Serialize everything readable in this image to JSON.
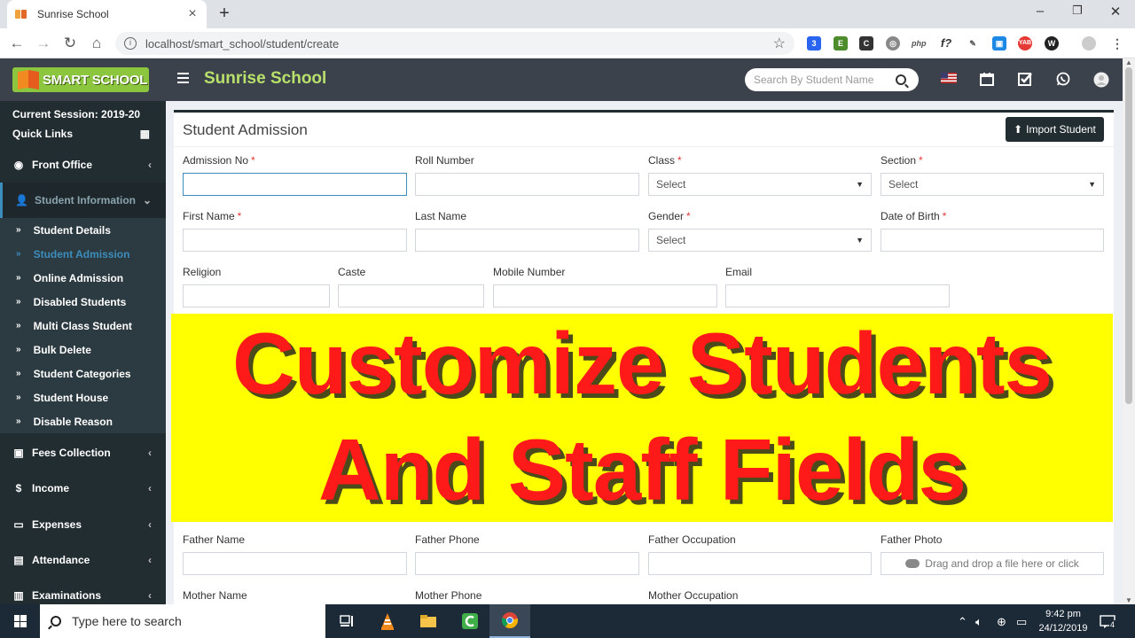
{
  "browser": {
    "tab_title": "Sunrise School",
    "tab_close": "×",
    "new_tab": "+",
    "url": "localhost/smart_school/student/create",
    "win_min": "–",
    "win_max": "❐",
    "win_close": "✕"
  },
  "header": {
    "logo_text": "SMART SCHOOL",
    "school_name": "Sunrise School",
    "search_placeholder": "Search By Student Name"
  },
  "sidebar": {
    "session": "Current Session: 2019-20",
    "quick_links": "Quick Links",
    "menus": [
      {
        "label": "Front Office",
        "icon": "desk-icon"
      },
      {
        "label": "Student Information",
        "icon": "user-plus-icon"
      },
      {
        "label": "Fees Collection",
        "icon": "money-icon"
      },
      {
        "label": "Income",
        "icon": "dollar-icon"
      },
      {
        "label": "Expenses",
        "icon": "card-icon"
      },
      {
        "label": "Attendance",
        "icon": "calendar-check-icon"
      },
      {
        "label": "Examinations",
        "icon": "map-icon"
      }
    ],
    "sub_items": [
      "Student Details",
      "Student Admission",
      "Online Admission",
      "Disabled Students",
      "Multi Class Student",
      "Bulk Delete",
      "Student Categories",
      "Student House",
      "Disable Reason"
    ]
  },
  "form": {
    "title": "Student Admission",
    "import_button": "Import Student",
    "labels": {
      "admission_no": "Admission No",
      "roll_number": "Roll Number",
      "class": "Class",
      "section": "Section",
      "first_name": "First Name",
      "last_name": "Last Name",
      "gender": "Gender",
      "dob": "Date of Birth",
      "religion": "Religion",
      "caste": "Caste",
      "mobile": "Mobile Number",
      "email": "Email",
      "father_name": "Father Name",
      "father_phone": "Father Phone",
      "father_occupation": "Father Occupation",
      "father_photo": "Father Photo",
      "mother_name": "Mother Name",
      "mother_phone": "Mother Phone",
      "mother_occupation": "Mother Occupation"
    },
    "required_mark": "*",
    "select_placeholder": "Select",
    "dropzone_text": "Drag and drop a file here or click"
  },
  "banner": {
    "line1": "Customize Students",
    "line2": "And Staff Fields"
  },
  "taskbar": {
    "search_text": "Type here to search",
    "time": "9:42 pm",
    "date": "24/12/2019",
    "notifications": "4"
  }
}
